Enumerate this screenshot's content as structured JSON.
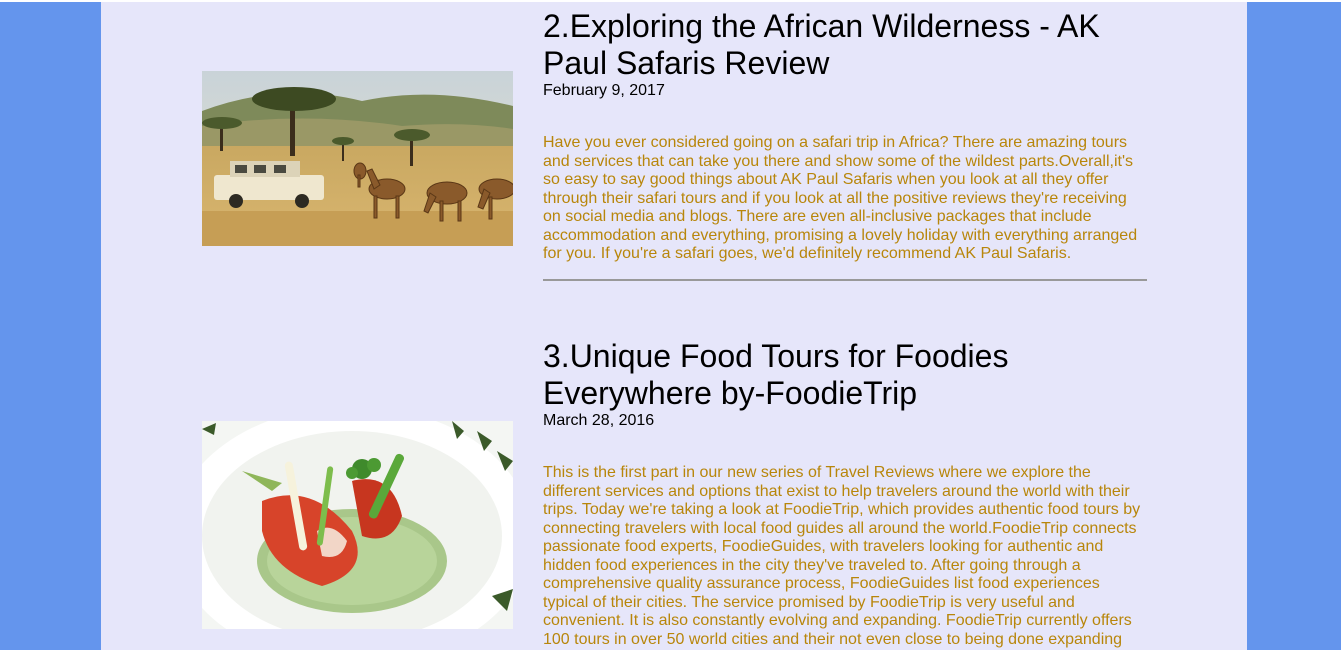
{
  "articles": [
    {
      "title": "2.Exploring the African Wilderness - AK Paul Safaris Review",
      "date": "February 9, 2017",
      "body": "Have you ever considered going on a safari trip in Africa? There are amazing tours and services that can take you there and show some of the wildest parts.Overall,it's so easy to say good things about AK Paul Safaris when you look at all they offer through their safari tours and if you look at all the positive reviews they're receiving on social media and blogs. There are even all-inclusive packages that include accommodation and everything, promising a lovely holiday with everything arranged for you. If you're a safari goes, we'd definitely recommend AK Paul Safaris."
    },
    {
      "title": "3.Unique Food Tours for Foodies Everywhere by-FoodieTrip",
      "date": "March 28, 2016",
      "body": "This is the first part in our new series of Travel Reviews where we explore the different services and options that exist to help travelers around the world with their trips. Today we're taking a look at FoodieTrip, which provides authentic food tours by connecting travelers with local food guides all around the world.FoodieTrip connects passionate food experts, FoodieGuides, with travelers looking for authentic and hidden food experiences in the city they've traveled to. After going through a comprehensive quality assurance process, FoodieGuides list food experiences typical of their cities. The service promised by FoodieTrip is very useful and convenient. It is also constantly evolving and expanding. FoodieTrip currently offers 100 tours in over 50 world cities and their not even close to being done expanding"
    }
  ]
}
